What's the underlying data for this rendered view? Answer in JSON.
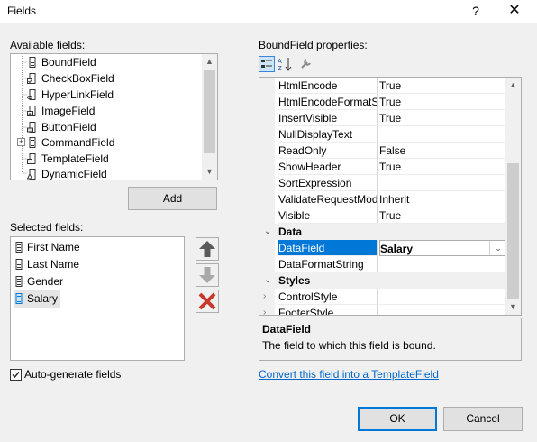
{
  "window": {
    "title": "Fields",
    "help_label": "?",
    "close_label": "✕"
  },
  "available": {
    "label": "Available fields:",
    "items": [
      {
        "label": "BoundField",
        "icon": "boundfield-icon"
      },
      {
        "label": "CheckBoxField",
        "icon": "checkboxfield-icon"
      },
      {
        "label": "HyperLinkField",
        "icon": "hyperlinkfield-icon"
      },
      {
        "label": "ImageField",
        "icon": "imagefield-icon"
      },
      {
        "label": "ButtonField",
        "icon": "buttonfield-icon"
      },
      {
        "label": "CommandField",
        "icon": "commandfield-icon",
        "expander": "+"
      },
      {
        "label": "TemplateField",
        "icon": "templatefield-icon"
      },
      {
        "label": "DynamicField",
        "icon": "dynamicfield-icon"
      }
    ],
    "add_label": "Add"
  },
  "selected": {
    "label": "Selected fields:",
    "items": [
      "First Name",
      "Last Name",
      "Gender",
      "Salary"
    ],
    "selected_index": 3
  },
  "autogen": {
    "label": "Auto-generate fields",
    "checked": true
  },
  "properties": {
    "label": "BoundField properties:",
    "rows": [
      {
        "name": "HtmlEncode",
        "value": "True"
      },
      {
        "name": "HtmlEncodeFormatString",
        "value": "True"
      },
      {
        "name": "InsertVisible",
        "value": "True"
      },
      {
        "name": "NullDisplayText",
        "value": ""
      },
      {
        "name": "ReadOnly",
        "value": "False"
      },
      {
        "name": "ShowHeader",
        "value": "True"
      },
      {
        "name": "SortExpression",
        "value": ""
      },
      {
        "name": "ValidateRequestMode",
        "value": "Inherit"
      },
      {
        "name": "Visible",
        "value": "True"
      }
    ],
    "data_category": "Data",
    "data_rows": [
      {
        "name": "DataField",
        "value": "Salary"
      },
      {
        "name": "DataFormatString",
        "value": ""
      }
    ],
    "styles_category": "Styles",
    "styles_rows": [
      {
        "name": "ControlStyle",
        "value": ""
      },
      {
        "name": "FooterStyle",
        "value": ""
      }
    ],
    "description_title": "DataField",
    "description_text": "The field to which this field is bound.",
    "convert_link": "Convert this field into a TemplateField"
  },
  "buttons": {
    "ok": "OK",
    "cancel": "Cancel"
  },
  "colors": {
    "selection": "#0078d7",
    "link": "#0066cc"
  }
}
